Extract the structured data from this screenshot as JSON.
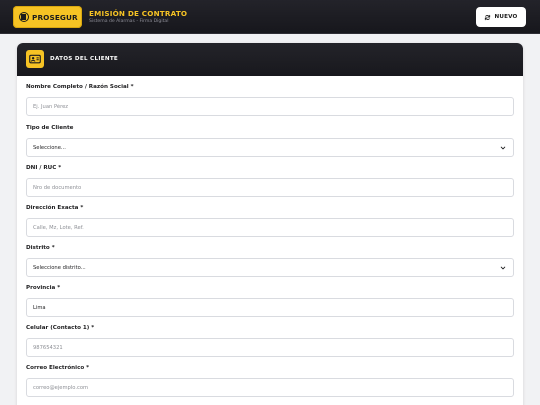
{
  "header": {
    "logo_text": "PROSEGUR",
    "title": "EMISIÓN DE CONTRATO",
    "subtitle": "Sistema de Alarmas - Firma Digital",
    "new_button_label": "NUEVO"
  },
  "card": {
    "title": "DATOS DEL CLIENTE"
  },
  "form": {
    "nombre": {
      "label": "Nombre Completo / Razón Social *",
      "placeholder": "Ej. Juan Pérez",
      "value": ""
    },
    "tipo": {
      "label": "Tipo de Cliente",
      "selected": "Seleccione..."
    },
    "dni": {
      "label": "DNI / RUC *",
      "placeholder": "Nro de documento",
      "value": ""
    },
    "direccion": {
      "label": "Dirección Exacta *",
      "placeholder": "Calle, Mz, Lote, Ref.",
      "value": ""
    },
    "distrito": {
      "label": "Distrito *",
      "selected": "Seleccione distrito..."
    },
    "provincia": {
      "label": "Provincia *",
      "placeholder": "",
      "value": "Lima"
    },
    "celular": {
      "label": "Celular (Contacto 1) *",
      "placeholder": "987654321",
      "value": ""
    },
    "correo": {
      "label": "Correo Electrónico *",
      "placeholder": "correo@ejemplo.com",
      "value": ""
    }
  },
  "colors": {
    "brand_yellow": "#f6c324",
    "header_dark": "#1c1c21",
    "page_bg": "#f1f2f4"
  }
}
